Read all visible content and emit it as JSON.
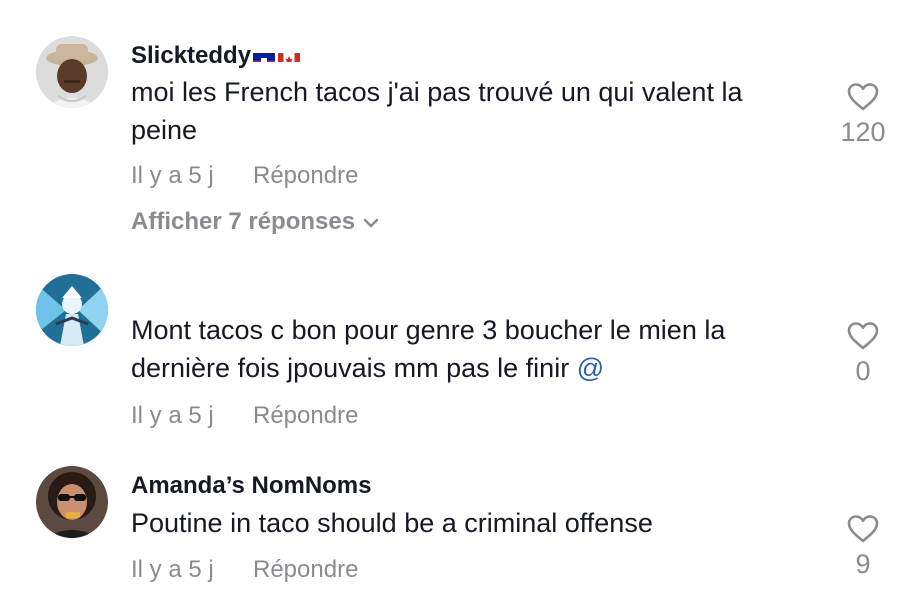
{
  "comments": [
    {
      "username": "Slickteddy",
      "flags": [
        "haiti-flag",
        "canada-flag"
      ],
      "text": "moi les French tacos j'ai pas trouvé un qui valent la peine",
      "time": "Il y a 5 j",
      "reply_label": "Répondre",
      "view_replies": "Afficher 7 réponses",
      "likes": "120"
    },
    {
      "username": "",
      "text": "Mont tacos c bon pour genre 3 boucher le mien la dernière fois jpouvais mm pas le finir",
      "mention": "@",
      "time": "Il y a 5 j",
      "reply_label": "Répondre",
      "likes": "0"
    },
    {
      "username": "Amanda’s NomNoms",
      "text": "Poutine in taco should be a criminal offense",
      "time": "Il y a 5 j",
      "reply_label": "Répondre",
      "likes": "9"
    }
  ],
  "colors": {
    "primary_text": "#161823",
    "secondary_text": "#8a8b91",
    "mention": "#2b5db6"
  }
}
